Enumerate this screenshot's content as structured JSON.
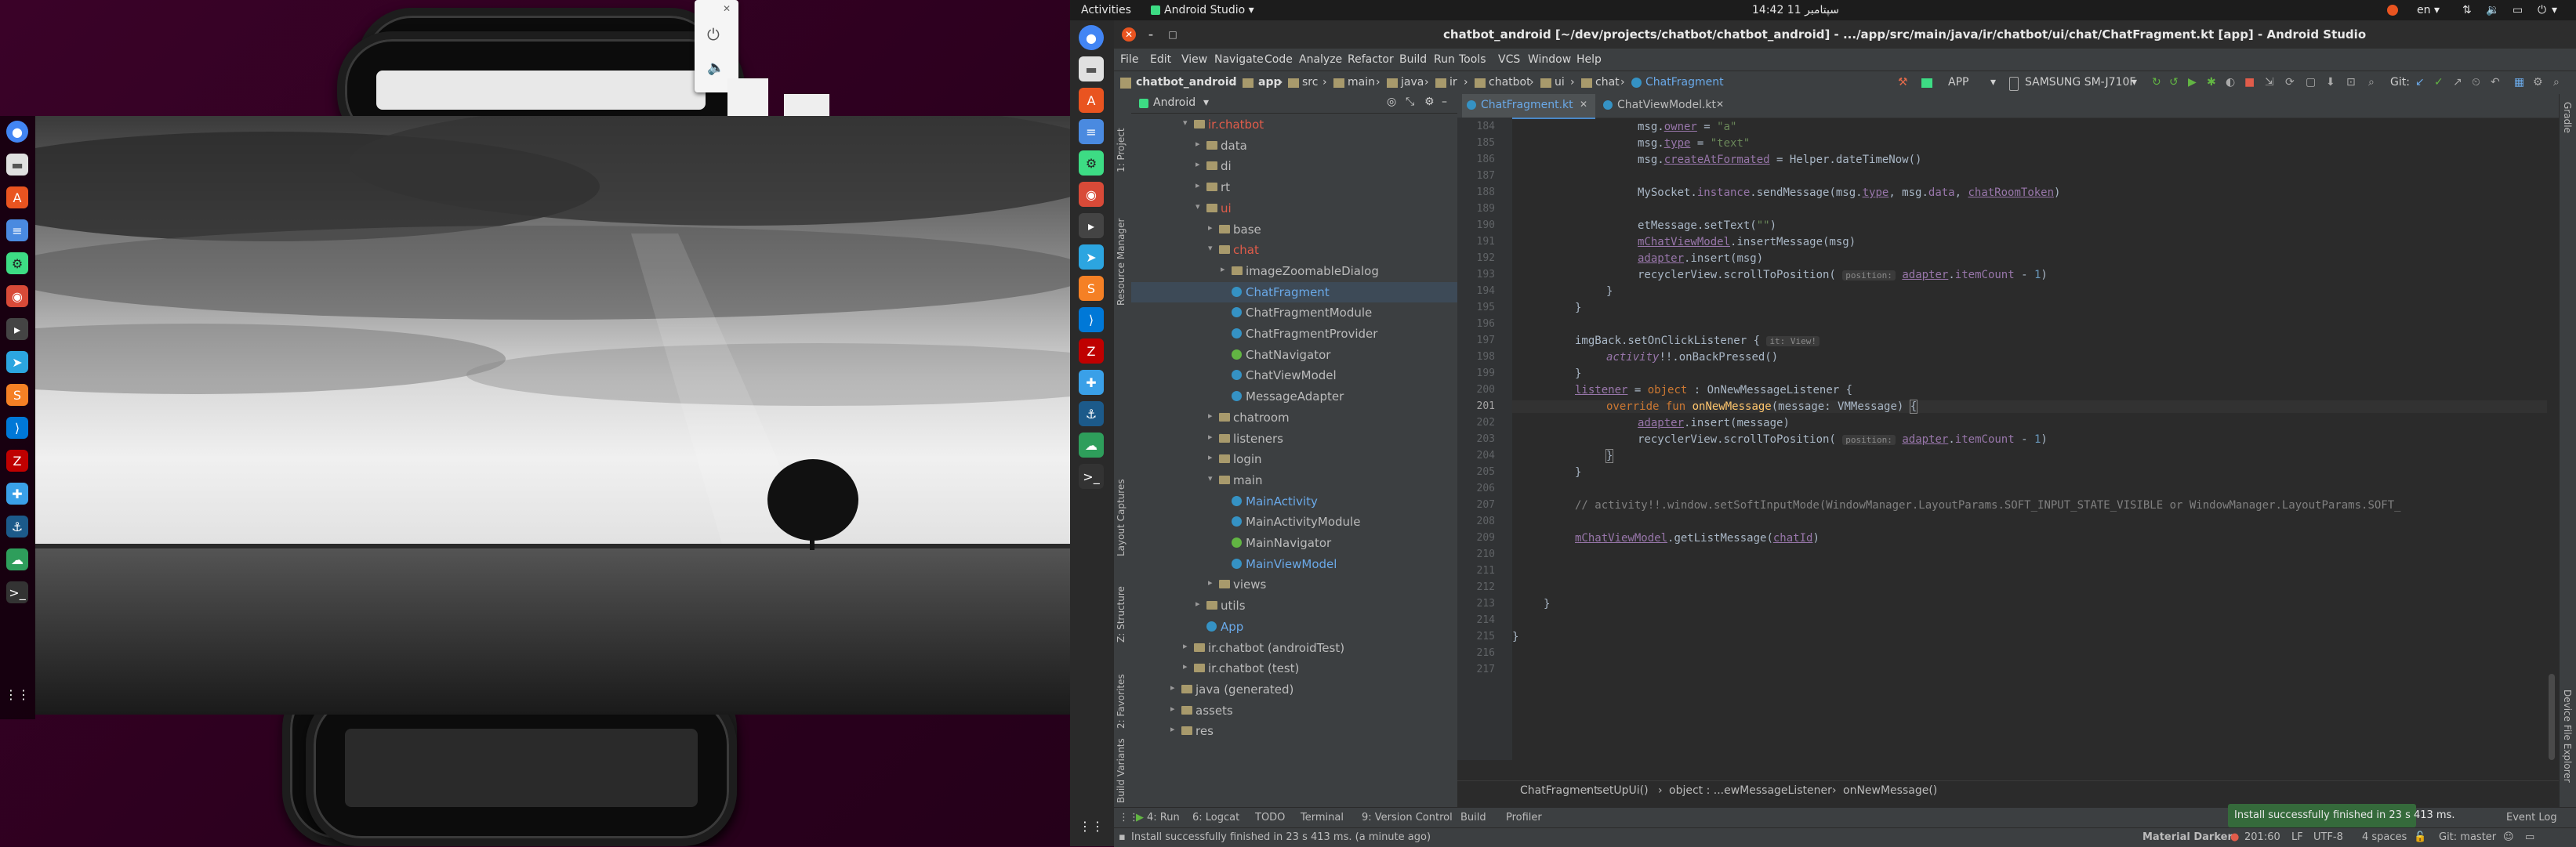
{
  "topbar": {
    "activities": "Activities",
    "app_menu": "Android Studio",
    "clock": "14:42  سپتامبر 11",
    "language": "en"
  },
  "window": {
    "title": "chatbot_android [~/dev/projects/chatbot/chatbot_android] - .../app/src/main/java/ir/chatbot/ui/chat/ChatFragment.kt [app] - Android Studio"
  },
  "menu": [
    "File",
    "Edit",
    "View",
    "Navigate",
    "Code",
    "Analyze",
    "Refactor",
    "Build",
    "Run",
    "Tools",
    "VCS",
    "Window",
    "Help"
  ],
  "navbar": {
    "crumbs": [
      "chatbot_android",
      "app",
      "src",
      "main",
      "java",
      "ir",
      "chatbot",
      "ui",
      "chat",
      "ChatFragment"
    ],
    "run_config": "APP",
    "device": "SAMSUNG SM-J710F",
    "git_label": "Git:"
  },
  "project_panel": {
    "view_selector": "Android",
    "side_tab_project": "1: Project",
    "side_tab_resource": "Resource Manager",
    "side_tab_layout": "Layout Captures",
    "side_tab_structure": "Z: Structure",
    "side_tab_favorites": "2: Favorites",
    "side_tab_build_variants": "Build Variants",
    "tree": [
      {
        "label": "ir.chatbot",
        "kind": "folder",
        "depth": 0,
        "open": true,
        "color": "#e05c4a"
      },
      {
        "label": "data",
        "kind": "folder",
        "depth": 1,
        "open": false
      },
      {
        "label": "di",
        "kind": "folder",
        "depth": 1,
        "open": false
      },
      {
        "label": "rt",
        "kind": "folder",
        "depth": 1,
        "open": false
      },
      {
        "label": "ui",
        "kind": "folder",
        "depth": 1,
        "open": true,
        "color": "#e05c4a"
      },
      {
        "label": "base",
        "kind": "folder",
        "depth": 2,
        "open": false
      },
      {
        "label": "chat",
        "kind": "folder",
        "depth": 2,
        "open": true,
        "color": "#e05c4a"
      },
      {
        "label": "imageZoomableDialog",
        "kind": "folder",
        "depth": 3,
        "open": false
      },
      {
        "label": "ChatFragment",
        "kind": "kfile",
        "depth": 3,
        "selected": true,
        "color": "#6aa9e8"
      },
      {
        "label": "ChatFragmentModule",
        "kind": "kfile",
        "depth": 3
      },
      {
        "label": "ChatFragmentProvider",
        "kind": "kfile",
        "depth": 3
      },
      {
        "label": "ChatNavigator",
        "kind": "nav",
        "depth": 3
      },
      {
        "label": "ChatViewModel",
        "kind": "kfile",
        "depth": 3
      },
      {
        "label": "MessageAdapter",
        "kind": "kfile",
        "depth": 3
      },
      {
        "label": "chatroom",
        "kind": "folder",
        "depth": 2,
        "open": false
      },
      {
        "label": "listeners",
        "kind": "folder",
        "depth": 2,
        "open": false
      },
      {
        "label": "login",
        "kind": "folder",
        "depth": 2,
        "open": false
      },
      {
        "label": "main",
        "kind": "folder",
        "depth": 2,
        "open": true
      },
      {
        "label": "MainActivity",
        "kind": "kfile",
        "depth": 3,
        "color": "#6aa9e8"
      },
      {
        "label": "MainActivityModule",
        "kind": "kfile",
        "depth": 3
      },
      {
        "label": "MainNavigator",
        "kind": "nav",
        "depth": 3
      },
      {
        "label": "MainViewModel",
        "kind": "kfile",
        "depth": 3,
        "color": "#6aa9e8"
      },
      {
        "label": "views",
        "kind": "folder",
        "depth": 2,
        "open": false
      },
      {
        "label": "utils",
        "kind": "folder",
        "depth": 1,
        "open": false
      },
      {
        "label": "App",
        "kind": "kfile",
        "depth": 1,
        "color": "#6aa9e8"
      },
      {
        "label": "ir.chatbot (androidTest)",
        "kind": "folder",
        "depth": 0,
        "open": false
      },
      {
        "label": "ir.chatbot (test)",
        "kind": "folder",
        "depth": 0,
        "open": false
      },
      {
        "label": "java (generated)",
        "kind": "folder",
        "depth": -1,
        "open": false
      },
      {
        "label": "assets",
        "kind": "folder",
        "depth": -1,
        "open": false
      },
      {
        "label": "res",
        "kind": "folder",
        "depth": -1,
        "open": false
      }
    ]
  },
  "editor": {
    "tabs": [
      {
        "label": "ChatFragment.kt",
        "active": true
      },
      {
        "label": "ChatViewModel.kt",
        "active": false
      }
    ],
    "line_numbers": [
      "184",
      "185",
      "186",
      "187",
      "188",
      "189",
      "190",
      "191",
      "192",
      "193",
      "194",
      "195",
      "196",
      "197",
      "198",
      "199",
      "200",
      "201",
      "202",
      "203",
      "204",
      "205",
      "206",
      "207",
      "208",
      "209",
      "210",
      "211",
      "212",
      "213",
      "214",
      "215",
      "216",
      "217"
    ],
    "breadcrumb": [
      "ChatFragment",
      "setUpUi()",
      "object : ...ewMessageListener",
      "onNewMessage()"
    ],
    "right_tabs": [
      "Gradle",
      "Device File Explorer"
    ]
  },
  "tool_windows": [
    "4: Run",
    "6: Logcat",
    "TODO",
    "Terminal",
    "9: Version Control",
    "Build",
    "Profiler",
    "Event Log"
  ],
  "status": {
    "message": "Install successfully finished in 23 s 413 ms. (a minute ago)",
    "theme": "Material Darker",
    "position": "201:60",
    "line_sep": "LF",
    "encoding": "UTF-8",
    "indent": "4 spaces",
    "vcs": "Git: master"
  },
  "toast": "Install successfully finished in 23 s 413 ms."
}
